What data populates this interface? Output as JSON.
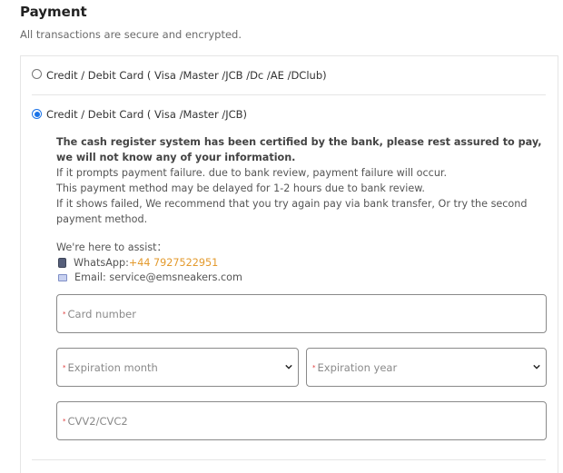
{
  "header": {
    "title": "Payment",
    "subtitle": "All transactions are secure and encrypted."
  },
  "options": [
    {
      "label": "Credit / Debit Card ( Visa /Master /JCB /Dc /AE /DClub)",
      "selected": false
    },
    {
      "label": "Credit / Debit Card ( Visa /Master /JCB)",
      "selected": true
    }
  ],
  "notice": {
    "bold_text": "The cash register system has been certified by the bank, please rest assured to pay, we will not know any of your information.",
    "line1": "If it prompts payment failure. due to bank review, payment failure will occur.",
    "line2": "This payment method may be delayed for 1-2 hours due to bank review.",
    "line3": "If it shows failed, We recommend that you try again pay via bank transfer, Or try the second payment method."
  },
  "assist": {
    "heading": "We're here to assist：",
    "whatsapp_label": "WhatsApp: ",
    "whatsapp_number": "+44 7927522951",
    "email_label": "Email: service@emsneakers.com",
    "whatsapp_icon": "phone-icon",
    "email_icon": "mail-icon"
  },
  "form": {
    "required_marker": "*",
    "card_number_placeholder": "Card number",
    "expiration_month_placeholder": "Expiration month",
    "expiration_year_placeholder": "Expiration year",
    "cvv_placeholder": "CVV2/CVC2"
  },
  "colors": {
    "accent": "#1a73e8",
    "highlight": "#e39a2d",
    "required": "#dd3333"
  }
}
